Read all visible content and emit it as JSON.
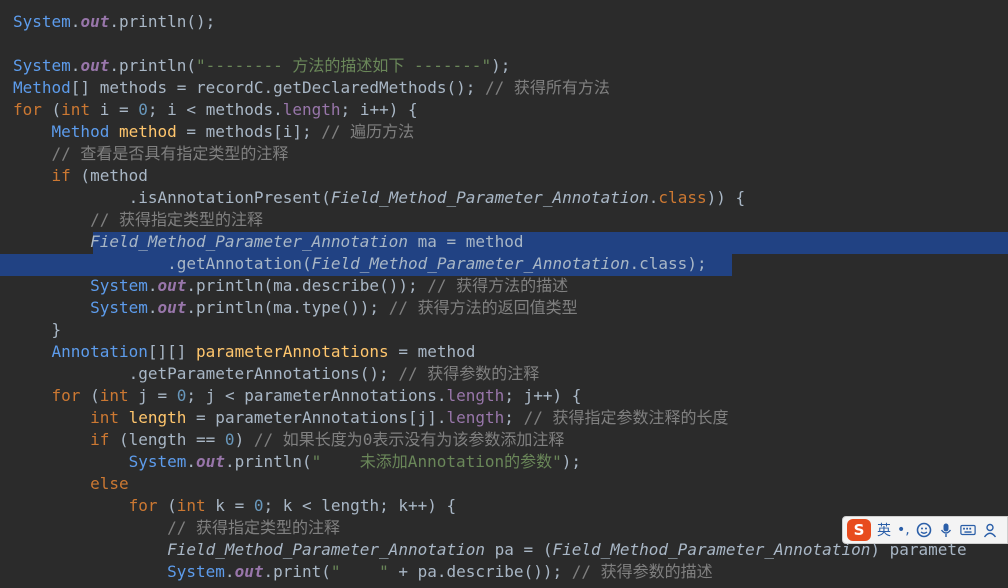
{
  "colors": {
    "background": "#2b2b2b",
    "plain": "#a9b7c6",
    "keyword": "#cc7832",
    "class": "#5d9cec",
    "field": "#9876aa",
    "method": "#ffc66d",
    "number": "#6897bb",
    "string": "#6a8759",
    "comment": "#808080",
    "annotation_type": "#a9b7c6",
    "selection": "#214283"
  },
  "editor": {
    "lines": [
      [
        [
          "sys",
          "System"
        ],
        [
          "p",
          "."
        ],
        [
          "field",
          "out"
        ],
        [
          "p",
          ".println();"
        ]
      ],
      [],
      [
        [
          "sys",
          "System"
        ],
        [
          "p",
          "."
        ],
        [
          "field",
          "out"
        ],
        [
          "p",
          ".println("
        ],
        [
          "str",
          "\"-------- 方法的描述如下 -------\""
        ],
        [
          "p",
          ");"
        ]
      ],
      [
        [
          "cls",
          "Method"
        ],
        [
          "p",
          "[] methods = recordC.getDeclaredMethods(); "
        ],
        [
          "cmt",
          "// 获得所有方法"
        ]
      ],
      [
        [
          "kw",
          "for"
        ],
        [
          "p",
          " ("
        ],
        [
          "kw",
          "int"
        ],
        [
          "p",
          " i = "
        ],
        [
          "num",
          "0"
        ],
        [
          "p",
          "; i < methods."
        ],
        [
          "field2",
          "length"
        ],
        [
          "p",
          "; i++) {"
        ]
      ],
      [
        [
          "p",
          "    "
        ],
        [
          "cls",
          "Method"
        ],
        [
          "p",
          " "
        ],
        [
          "var",
          "method"
        ],
        [
          "p",
          " = methods[i]; "
        ],
        [
          "cmt",
          "// 遍历方法"
        ]
      ],
      [
        [
          "p",
          "    "
        ],
        [
          "cmt",
          "// 查看是否具有指定类型的注释"
        ]
      ],
      [
        [
          "p",
          "    "
        ],
        [
          "kw",
          "if"
        ],
        [
          "p",
          " (method"
        ]
      ],
      [
        [
          "p",
          "            .isAnnotationPresent("
        ],
        [
          "it",
          "Field_Method_Parameter_Annotation"
        ],
        [
          "p",
          "."
        ],
        [
          "kw",
          "class"
        ],
        [
          "p",
          ")) {"
        ]
      ],
      [
        [
          "p",
          "        "
        ],
        [
          "cmt",
          "// 获得指定类型的注释"
        ]
      ],
      [
        [
          "p",
          "        "
        ],
        [
          "it",
          "Field_Method_Parameter_Annotation"
        ],
        [
          "p",
          " ma = method"
        ]
      ],
      [
        [
          "p",
          "                .getAnnotation("
        ],
        [
          "it",
          "Field_Method_Parameter_Annotation"
        ],
        [
          "p",
          ".class);"
        ]
      ],
      [
        [
          "p",
          "        "
        ],
        [
          "sys",
          "System"
        ],
        [
          "p",
          "."
        ],
        [
          "field",
          "out"
        ],
        [
          "p",
          ".println(ma.describe()); "
        ],
        [
          "cmt",
          "// 获得方法的描述"
        ]
      ],
      [
        [
          "p",
          "        "
        ],
        [
          "sys",
          "System"
        ],
        [
          "p",
          "."
        ],
        [
          "field",
          "out"
        ],
        [
          "p",
          ".println(ma.type()); "
        ],
        [
          "cmt",
          "// 获得方法的返回值类型"
        ]
      ],
      [
        [
          "p",
          "    }"
        ]
      ],
      [
        [
          "p",
          "    "
        ],
        [
          "cls",
          "Annotation"
        ],
        [
          "p",
          "[][] "
        ],
        [
          "var",
          "parameterAnnotations"
        ],
        [
          "p",
          " = method"
        ]
      ],
      [
        [
          "p",
          "            .getParameterAnnotations(); "
        ],
        [
          "cmt",
          "// 获得参数的注释"
        ]
      ],
      [
        [
          "p",
          "    "
        ],
        [
          "kw",
          "for"
        ],
        [
          "p",
          " ("
        ],
        [
          "kw",
          "int"
        ],
        [
          "p",
          " j = "
        ],
        [
          "num",
          "0"
        ],
        [
          "p",
          "; j < parameterAnnotations."
        ],
        [
          "field2",
          "length"
        ],
        [
          "p",
          "; j++) {"
        ]
      ],
      [
        [
          "p",
          "        "
        ],
        [
          "kw",
          "int"
        ],
        [
          "p",
          " "
        ],
        [
          "var",
          "length"
        ],
        [
          "p",
          " = parameterAnnotations[j]."
        ],
        [
          "field2",
          "length"
        ],
        [
          "p",
          "; "
        ],
        [
          "cmt",
          "// 获得指定参数注释的长度"
        ]
      ],
      [
        [
          "p",
          "        "
        ],
        [
          "kw",
          "if"
        ],
        [
          "p",
          " (length == "
        ],
        [
          "num",
          "0"
        ],
        [
          "p",
          ") "
        ],
        [
          "cmt",
          "// 如果长度为0表示没有为该参数添加注释"
        ]
      ],
      [
        [
          "p",
          "            "
        ],
        [
          "sys",
          "System"
        ],
        [
          "p",
          "."
        ],
        [
          "field",
          "out"
        ],
        [
          "p",
          ".println("
        ],
        [
          "str",
          "\"    未添加Annotation的参数\""
        ],
        [
          "p",
          ");"
        ]
      ],
      [
        [
          "p",
          "        "
        ],
        [
          "kw",
          "else"
        ]
      ],
      [
        [
          "p",
          "            "
        ],
        [
          "kw",
          "for"
        ],
        [
          "p",
          " ("
        ],
        [
          "kw",
          "int"
        ],
        [
          "p",
          " k = "
        ],
        [
          "num",
          "0"
        ],
        [
          "p",
          "; k < length; k++) {"
        ]
      ],
      [
        [
          "p",
          "                "
        ],
        [
          "cmt",
          "// 获得指定类型的注释"
        ]
      ],
      [
        [
          "p",
          "                "
        ],
        [
          "it",
          "Field_Method_Parameter_Annotation"
        ],
        [
          "p",
          " pa = ("
        ],
        [
          "it",
          "Field_Method_Parameter_Annotation"
        ],
        [
          "p",
          ") paramete"
        ]
      ],
      [
        [
          "p",
          "                "
        ],
        [
          "sys",
          "System"
        ],
        [
          "p",
          "."
        ],
        [
          "field",
          "out"
        ],
        [
          "p",
          ".print("
        ],
        [
          "str",
          "\"    \""
        ],
        [
          "p",
          " + pa.describe()); "
        ],
        [
          "cmt",
          "// 获得参数的描述"
        ]
      ]
    ]
  },
  "ime": {
    "logo": "S",
    "mode": "英",
    "punct": "•,"
  }
}
